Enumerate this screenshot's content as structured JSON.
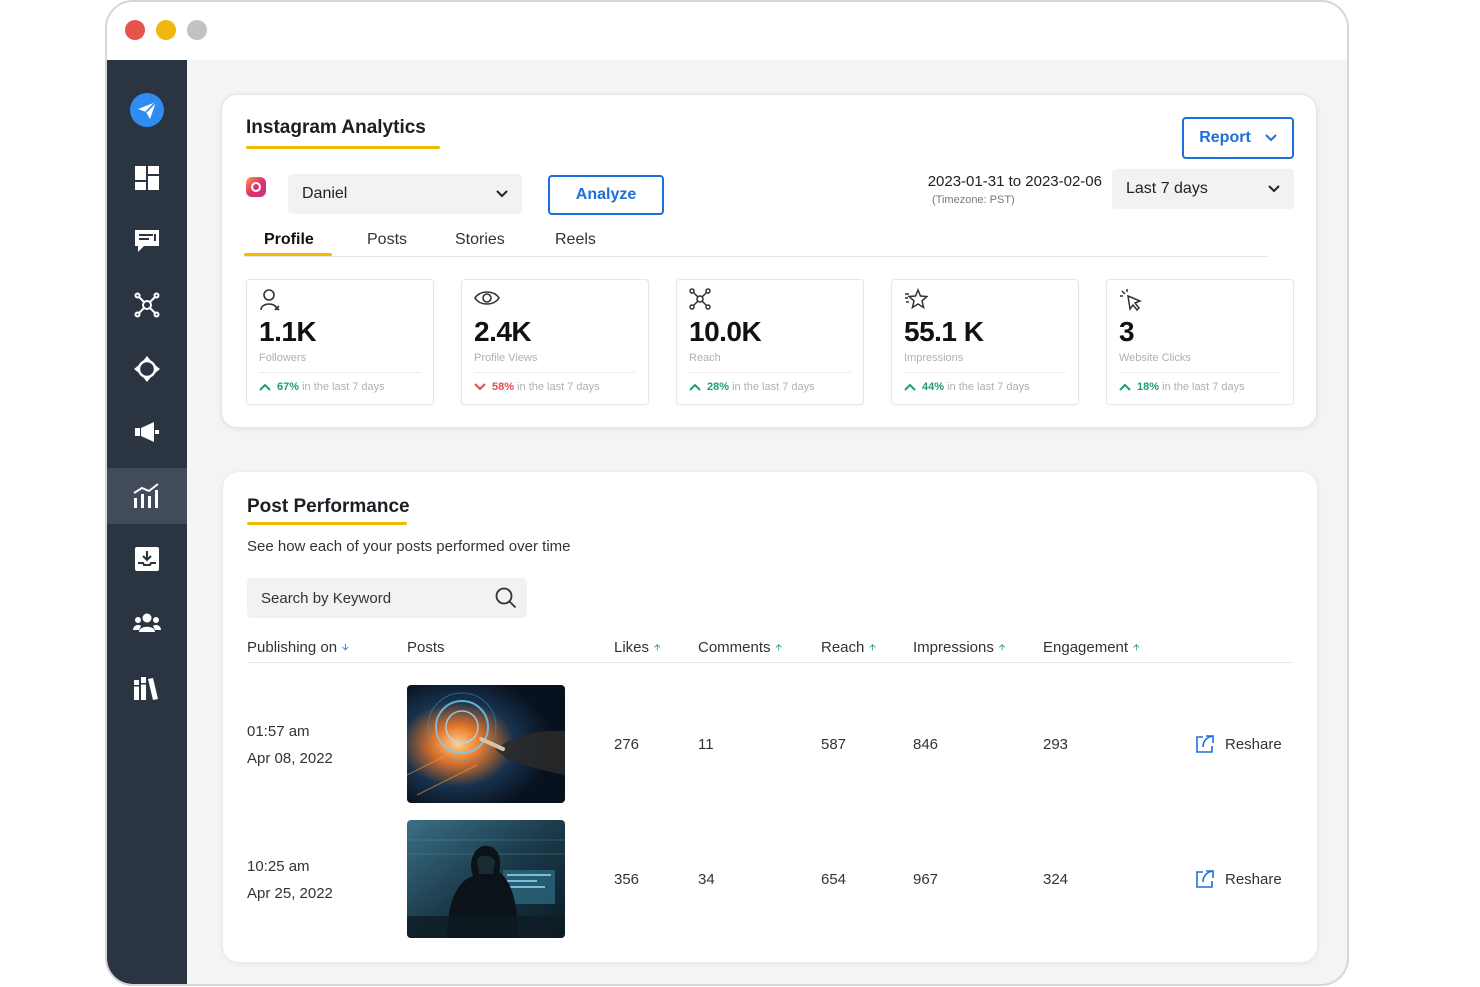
{
  "window": {
    "controls": [
      "close",
      "minimize",
      "maximize"
    ]
  },
  "sidebar": {
    "items": [
      {
        "icon": "paper-plane-icon",
        "active": false
      },
      {
        "icon": "dashboard-icon",
        "active": false
      },
      {
        "icon": "chat-icon",
        "active": false
      },
      {
        "icon": "network-icon",
        "active": false
      },
      {
        "icon": "move-icon",
        "active": false
      },
      {
        "icon": "megaphone-icon",
        "active": false
      },
      {
        "icon": "analytics-icon",
        "active": true
      },
      {
        "icon": "inbox-download-icon",
        "active": false
      },
      {
        "icon": "users-icon",
        "active": false
      },
      {
        "icon": "library-icon",
        "active": false
      }
    ]
  },
  "analytics": {
    "title": "Instagram Analytics",
    "report_label": "Report",
    "account": "Daniel",
    "analyze_label": "Analyze",
    "date_range": "2023-01-31 to 2023-02-06",
    "timezone": "(Timezone: PST)",
    "period": "Last 7 days",
    "tabs": [
      "Profile",
      "Posts",
      "Stories",
      "Reels"
    ],
    "active_tab": "Profile",
    "metrics": [
      {
        "icon": "user-icon",
        "value": "1.1K",
        "label": "Followers",
        "pct": "67%",
        "trend": "up",
        "suffix": "in the last 7 days"
      },
      {
        "icon": "eye-icon",
        "value": "2.4K",
        "label": "Profile Views",
        "pct": "58%",
        "trend": "down",
        "suffix": "in the last 7 days"
      },
      {
        "icon": "reach-icon",
        "value": "10.0K",
        "label": "Reach",
        "pct": "28%",
        "trend": "up",
        "suffix": "in the last 7 days"
      },
      {
        "icon": "star-icon",
        "value": "55.1 K",
        "label": "Impressions",
        "pct": "44%",
        "trend": "up",
        "suffix": "in the last 7 days"
      },
      {
        "icon": "cursor-click-icon",
        "value": "3",
        "label": "Website Clicks",
        "pct": "18%",
        "trend": "up",
        "suffix": "in the last 7 days"
      }
    ]
  },
  "performance": {
    "title": "Post Performance",
    "subtitle": "See how each of your posts performed over time",
    "search_placeholder": "Search by Keyword",
    "columns": [
      {
        "label": "Publishing on",
        "sort": "down"
      },
      {
        "label": "Posts",
        "sort": ""
      },
      {
        "label": "Likes",
        "sort": "up"
      },
      {
        "label": "Comments",
        "sort": "up"
      },
      {
        "label": "Reach",
        "sort": "up"
      },
      {
        "label": "Impressions",
        "sort": "up"
      },
      {
        "label": "Engagement",
        "sort": "up"
      }
    ],
    "rows": [
      {
        "time": "01:57 am",
        "date": "Apr 08, 2022",
        "likes": "276",
        "comments": "11",
        "reach": "587",
        "impressions": "846",
        "engagement": "293",
        "action": "Reshare"
      },
      {
        "time": "10:25 am",
        "date": "Apr 25, 2022",
        "likes": "356",
        "comments": "34",
        "reach": "654",
        "impressions": "967",
        "engagement": "324",
        "action": "Reshare"
      }
    ]
  },
  "colors": {
    "accent": "#1e6fd9",
    "highlight": "#f5b800",
    "sidebar": "#2b3542",
    "up": "#1e9e6a",
    "down": "#e24b4b"
  }
}
